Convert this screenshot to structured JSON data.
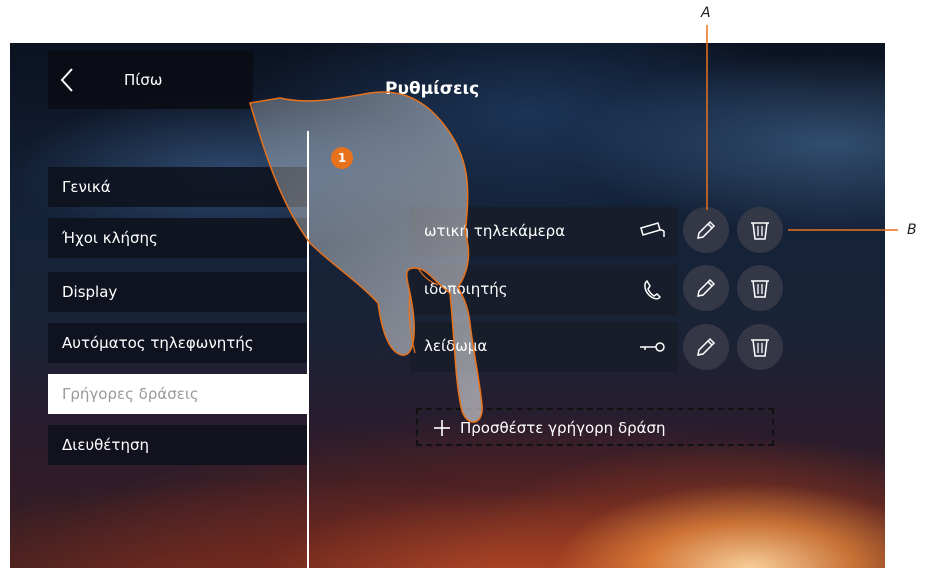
{
  "header": {
    "back_label": "Πίσω",
    "title": "Ρυθμίσεις"
  },
  "menu": {
    "items": [
      {
        "label": "Γενικά"
      },
      {
        "label": "Ήχοι κλήσης"
      },
      {
        "label": "Display"
      },
      {
        "label": "Αυτόματος τηλεφωνητής"
      },
      {
        "label": "Γρήγορες δράσεις"
      },
      {
        "label": "Διευθέτηση"
      }
    ],
    "selected": "Γρήγορες δράσεις"
  },
  "quick_actions": [
    {
      "label": "ωτική τηλεκάμερα",
      "icon": "camera-icon"
    },
    {
      "label": "ιδοποιητής",
      "icon": "phone-icon"
    },
    {
      "label": "λείδωμα",
      "icon": "key-icon"
    }
  ],
  "add_action_label": "Προσθέστε γρήγορη δράση",
  "step_number": "1",
  "callouts": {
    "a": "A",
    "b": "B"
  },
  "colors": {
    "accent": "#e8721c",
    "selected_bg": "#ffffff",
    "selected_text": "#9a9a9a"
  }
}
